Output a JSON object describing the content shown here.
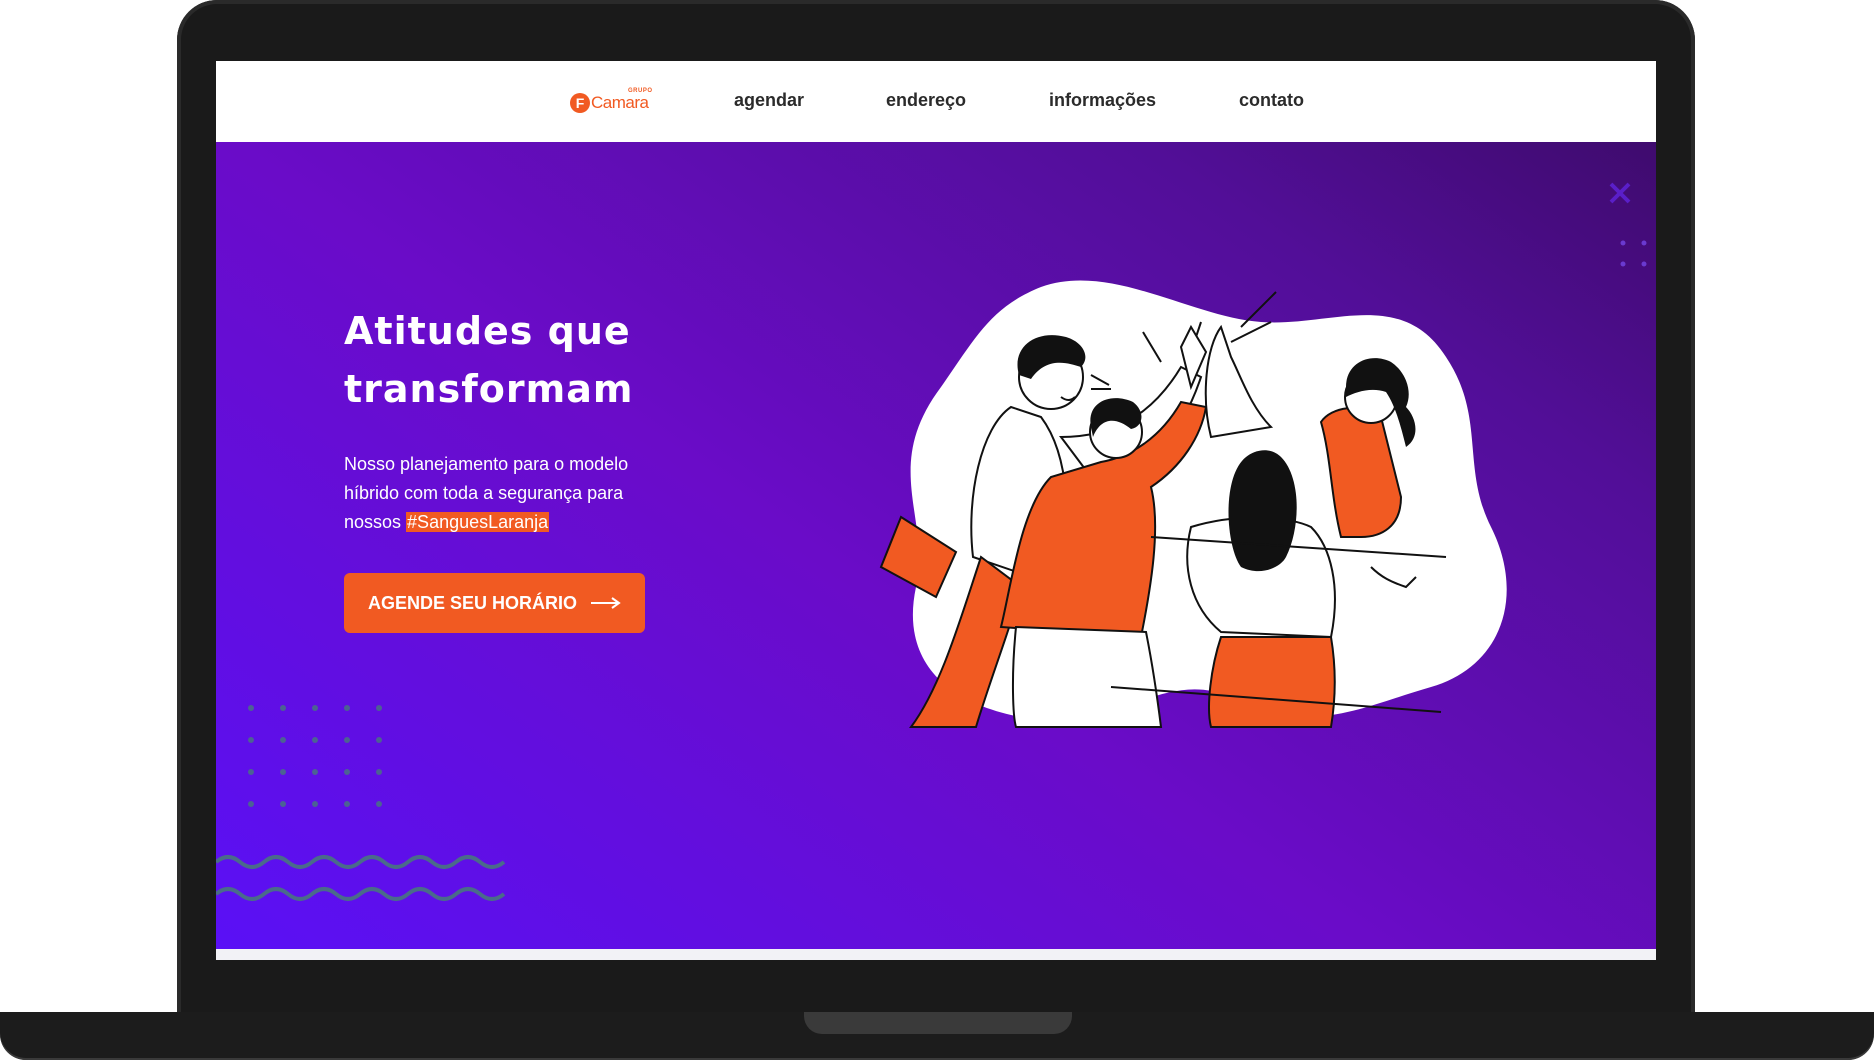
{
  "nav": {
    "logo_text": "Camara",
    "logo_mark": "F",
    "logo_small": "GRUPO",
    "links": [
      "agendar",
      "endereço",
      "informações",
      "contato"
    ]
  },
  "hero": {
    "title": "Atitudes que transformam",
    "text_before": "Nosso planejamento para o modelo híbrido com toda a segurança para nossos ",
    "hashtag": "#SanguesLaranja",
    "cta_label": "AGENDE SEU HORÁRIO",
    "cta_icon": "arrow-right-icon"
  },
  "colors": {
    "accent": "#f15a22",
    "hero_gradient_start": "#5a10f6",
    "hero_gradient_end": "#3f0b6e",
    "nav_text": "#2b2b2b"
  }
}
